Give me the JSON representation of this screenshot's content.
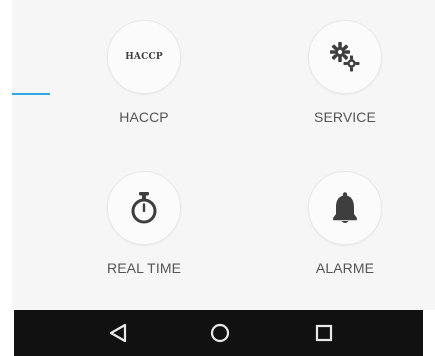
{
  "colors": {
    "accent": "#2da9e1",
    "panel_background": "#f6f6f6",
    "icon": "#3e3e3e",
    "label": "#555555",
    "navbar": "#111111"
  },
  "menu": {
    "items": [
      {
        "label": "HACCP",
        "icon_text": "HACCP",
        "icon": "haccp-text-icon"
      },
      {
        "label": "SERVICE",
        "icon": "gears-icon"
      },
      {
        "label": "REAL TIME",
        "icon": "stopwatch-icon"
      },
      {
        "label": "ALARME",
        "icon": "bell-icon"
      }
    ]
  },
  "navbar": {
    "buttons": [
      {
        "name": "back",
        "icon": "back-triangle-icon"
      },
      {
        "name": "home",
        "icon": "home-circle-icon"
      },
      {
        "name": "recents",
        "icon": "recents-square-icon"
      }
    ]
  }
}
